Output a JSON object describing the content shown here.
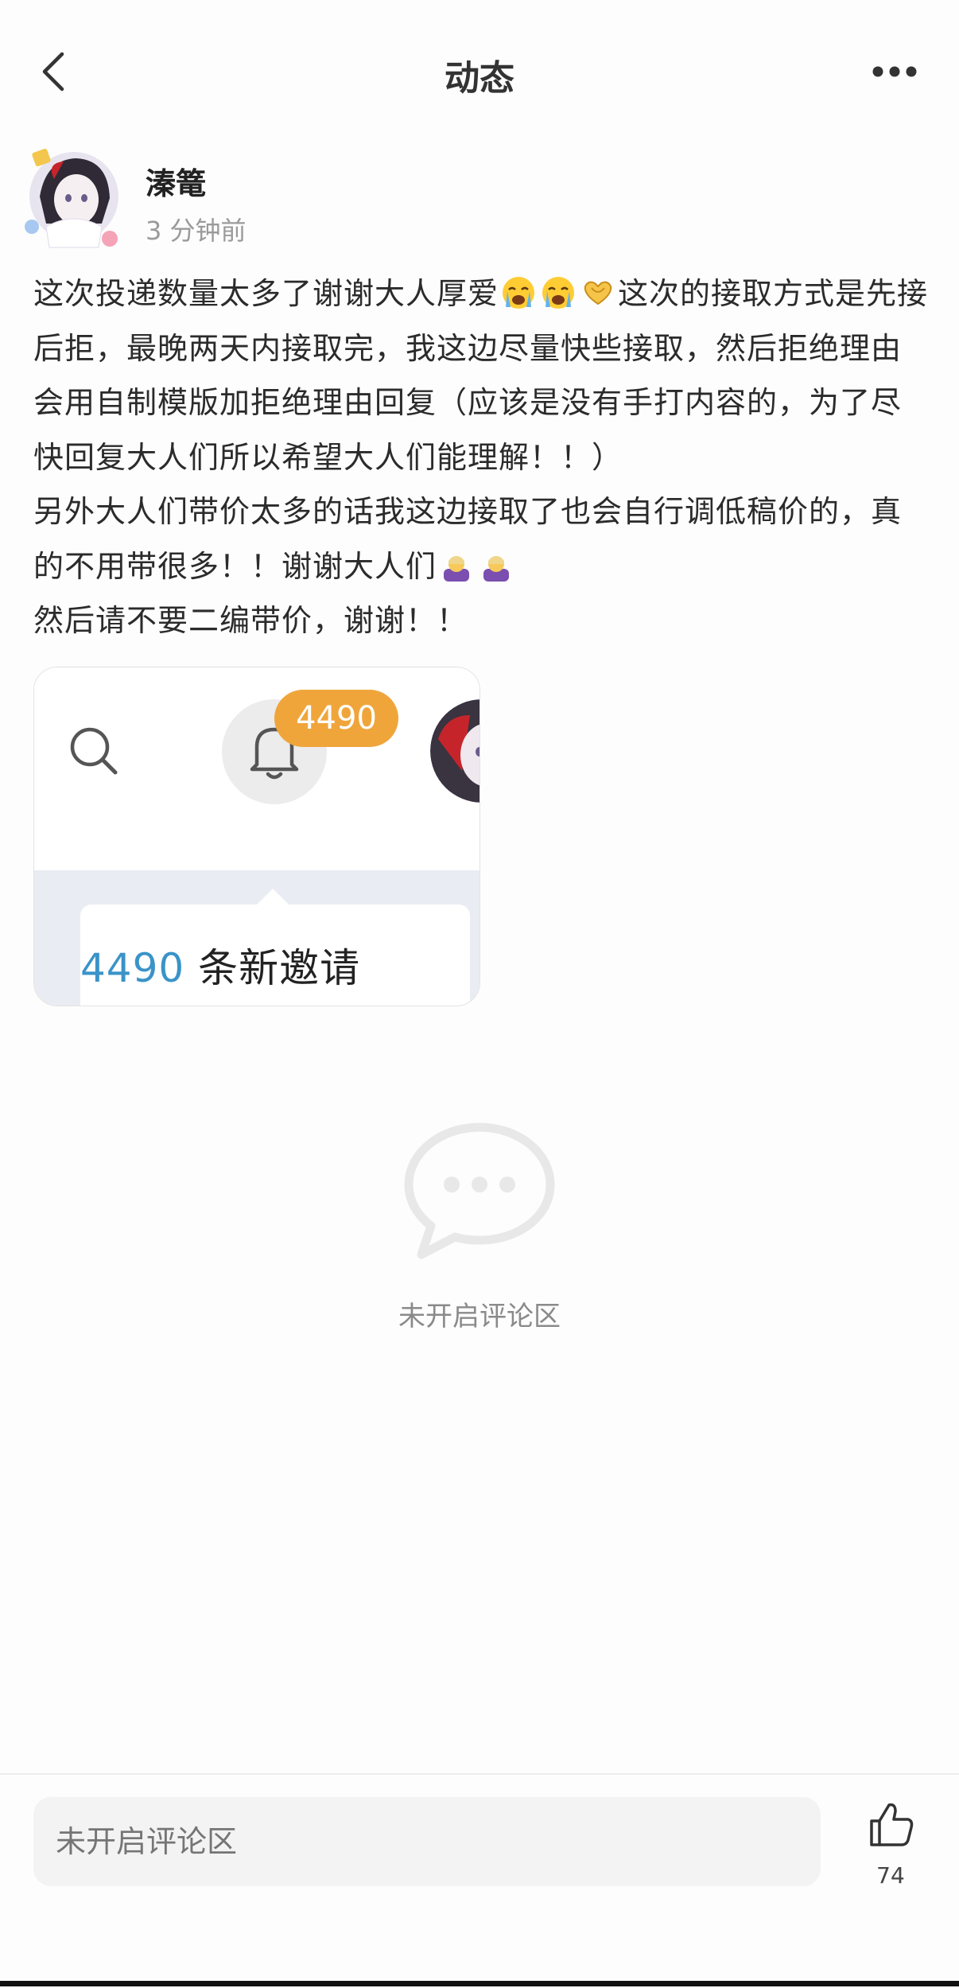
{
  "header": {
    "title": "动态",
    "back_icon": "chevron-left-icon",
    "more_icon": "more-dots-icon"
  },
  "author": {
    "name": "溱篭",
    "time": "3 分钟前"
  },
  "post": {
    "paragraphs": [
      {
        "before": "这次投递数量太多了谢谢大人厚爱",
        "emojis": [
          "crying-face-emoji",
          "crying-face-emoji",
          "heart-hands-emoji"
        ],
        "after": "这次的接取方式是先接后拒，最晚两天内接取完，我这边尽量快些接取，然后拒绝理由会用自制模版加拒绝理由回复（应该是没有手打内容的，为了尽快回复大人们所以希望大人们能理解！！）"
      },
      {
        "before": "另外大人们带价太多的话我这边接取了也会自行调低稿价的，真的不用带很多！！谢谢大人们",
        "emojis": [
          "bowing-person-emoji",
          "bowing-person-emoji"
        ],
        "after": ""
      },
      {
        "before": "然后请不要二编带价，谢谢！！",
        "emojis": [],
        "after": ""
      }
    ]
  },
  "image": {
    "badge_count": "4490",
    "invite_count": "4490",
    "invite_label": "条新邀请"
  },
  "comments": {
    "empty_text": "未开启评论区"
  },
  "bottom_bar": {
    "input_placeholder": "未开启评论区",
    "like_count": "74"
  },
  "colors": {
    "badge": "#f0a53b",
    "invite_number": "#3a93c9"
  }
}
